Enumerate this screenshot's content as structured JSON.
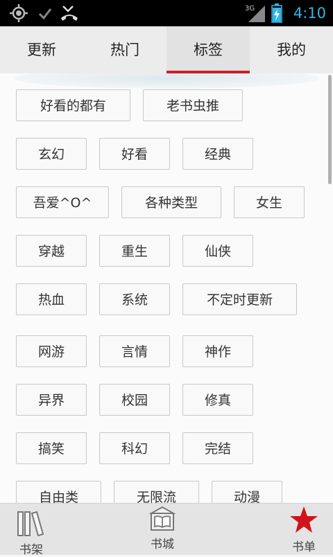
{
  "status_bar": {
    "time": "4:10",
    "network": "3G",
    "icons": [
      "gps-icon",
      "check-icon",
      "missed-call-icon",
      "signal-icon",
      "battery-icon"
    ]
  },
  "tabs": [
    {
      "label": "更新",
      "active": false
    },
    {
      "label": "热门",
      "active": false
    },
    {
      "label": "标签",
      "active": true
    },
    {
      "label": "我的",
      "active": false
    }
  ],
  "tags": [
    "好看的都有",
    "老书虫推",
    "玄幻",
    "好看",
    "经典",
    "吾爱^O^",
    "各种类型",
    "女生",
    "穿越",
    "重生",
    "仙侠",
    "热血",
    "系统",
    "不定时更新",
    "网游",
    "言情",
    "神作",
    "异界",
    "校园",
    "修真",
    "搞笑",
    "科幻",
    "完结",
    "自由类",
    "无限流",
    "动漫"
  ],
  "bottom_nav": [
    {
      "label": "书架",
      "icon": "bookshelf-icon"
    },
    {
      "label": "书城",
      "icon": "bookstore-icon"
    },
    {
      "label": "书单",
      "icon": "star-icon"
    }
  ],
  "colors": {
    "accent_red": "#cc1f24",
    "status_blue": "#33b5e5"
  }
}
